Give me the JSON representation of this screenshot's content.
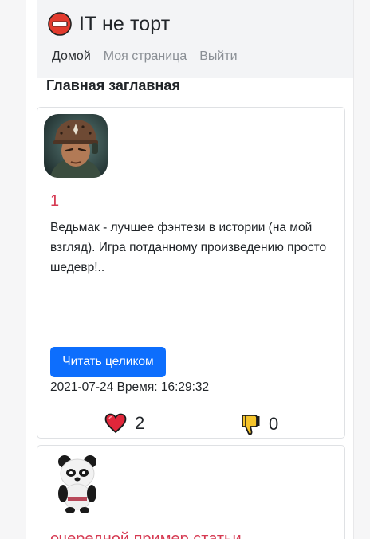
{
  "brand": {
    "title": "IT не торт",
    "logo_icon": "no-entry-icon"
  },
  "nav": {
    "items": [
      {
        "label": "Домой",
        "active": true
      },
      {
        "label": "Моя страница",
        "active": false
      },
      {
        "label": "Выйти",
        "active": false
      }
    ]
  },
  "section_title": "Главная заглавная",
  "posts": [
    {
      "avatar_icon": "soldier-helmet-avatar",
      "title": "1",
      "text": "Ведьмак - лучшее фэнтези в истории (на мой взгляд). Игра потданному произведению просто шедевр!..",
      "button_label": "Читать целиком",
      "meta": "2021-07-24 Время: 16:29:32",
      "likes": "2",
      "dislikes": "0",
      "like_icon": "heart-icon",
      "dislike_icon": "thumbs-down-icon"
    },
    {
      "avatar_icon": "panda-avatar",
      "title": "очередной пример статьи"
    }
  ],
  "colors": {
    "accent": "#0d6efd",
    "title": "#d63a52",
    "header_bg": "#f3f4f6"
  }
}
